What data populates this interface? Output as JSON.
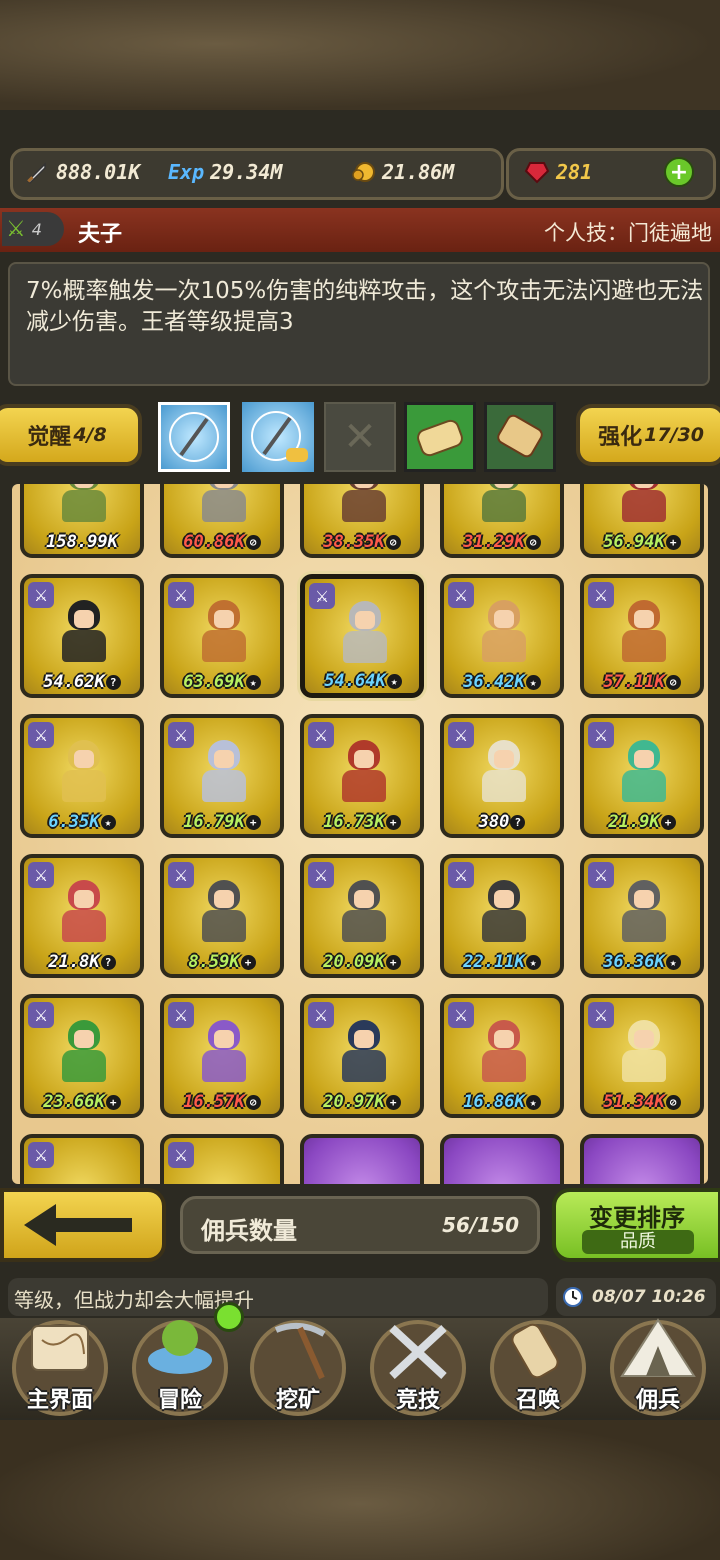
{
  "currencies": {
    "attack": "888.01K",
    "exp_label": "Exp",
    "exp": "29.34M",
    "gold": "21.86M",
    "gems": "281"
  },
  "hero": {
    "level": "4",
    "name": "夫子",
    "skill_title": "个人技：门徒遍地",
    "description": "7%概率触发一次105%伤害的纯粹攻击，这个攻击无法闪避也无法减少伤害。王者等级提高3"
  },
  "awaken": {
    "label": "觉醒",
    "value": "4/8"
  },
  "enhance": {
    "label": "强化",
    "value": "17/30"
  },
  "grid": {
    "rows": [
      [
        {
          "power": "158.99K",
          "color": "white",
          "badge": "",
          "tone": "#6a8a3a"
        },
        {
          "power": "60.86K",
          "color": "red",
          "badge": "⊘",
          "tone": "#8a8a8a"
        },
        {
          "power": "38.35K",
          "color": "red",
          "badge": "⊘",
          "tone": "#6a4030"
        },
        {
          "power": "31.29K",
          "color": "red",
          "badge": "⊘",
          "tone": "#5a7a3a"
        },
        {
          "power": "56.94K",
          "color": "green",
          "badge": "+",
          "tone": "#a03030"
        }
      ],
      [
        {
          "power": "54.62K",
          "color": "white",
          "badge": "?",
          "tone": "#222222"
        },
        {
          "power": "63.69K",
          "color": "green",
          "badge": "★",
          "tone": "#c07030"
        },
        {
          "power": "54.64K",
          "color": "blue",
          "badge": "★",
          "tone": "#b8b8b8"
        },
        {
          "power": "36.42K",
          "color": "blue",
          "badge": "★",
          "tone": "#d8a060"
        },
        {
          "power": "57.11K",
          "color": "red",
          "badge": "⊘",
          "tone": "#c06a30"
        }
      ],
      [
        {
          "power": "6.35K",
          "color": "blue",
          "badge": "★",
          "tone": "#e0c050"
        },
        {
          "power": "16.79K",
          "color": "green",
          "badge": "+",
          "tone": "#b8c0d8"
        },
        {
          "power": "16.73K",
          "color": "green",
          "badge": "+",
          "tone": "#b03a2a"
        },
        {
          "power": "380",
          "color": "white",
          "badge": "?",
          "tone": "#e8e0c8"
        },
        {
          "power": "21.9K",
          "color": "green",
          "badge": "+",
          "tone": "#40b890"
        }
      ],
      [
        {
          "power": "21.8K",
          "color": "white",
          "badge": "?",
          "tone": "#c84a4a"
        },
        {
          "power": "8.59K",
          "color": "green",
          "badge": "+",
          "tone": "#505050"
        },
        {
          "power": "20.09K",
          "color": "green",
          "badge": "+",
          "tone": "#505050"
        },
        {
          "power": "22.11K",
          "color": "blue",
          "badge": "★",
          "tone": "#3a3a3a"
        },
        {
          "power": "36.36K",
          "color": "blue",
          "badge": "★",
          "tone": "#606060"
        }
      ],
      [
        {
          "power": "23.66K",
          "color": "green",
          "badge": "+",
          "tone": "#3a9a3a"
        },
        {
          "power": "16.57K",
          "color": "red",
          "badge": "⊘",
          "tone": "#8a5ac8"
        },
        {
          "power": "20.97K",
          "color": "green",
          "badge": "+",
          "tone": "#2a3a5a"
        },
        {
          "power": "16.86K",
          "color": "blue",
          "badge": "★",
          "tone": "#c85a4a"
        },
        {
          "power": "51.34K",
          "color": "red",
          "badge": "⊘",
          "tone": "#f0e0a0"
        }
      ]
    ]
  },
  "count": {
    "label": "佣兵数量",
    "value": "56/150"
  },
  "sort": {
    "label": "变更排序",
    "sub": "品质"
  },
  "ticker": "等级，但战力却会大幅提升",
  "clock": "08/07 10:26",
  "nav": [
    "主界面",
    "冒险",
    "挖矿",
    "竞技",
    "召唤",
    "佣兵"
  ]
}
